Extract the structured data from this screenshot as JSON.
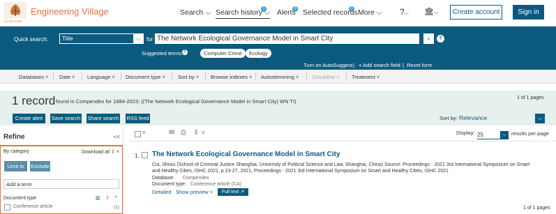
{
  "header": {
    "logo_name": "ELSEVIER",
    "app_title": "Engineering Village",
    "nav": {
      "search": "Search",
      "search_history": "Search history",
      "search_history_badge": "1",
      "alerts": "Alerts",
      "alerts_badge": "0",
      "selected_records": "Selected records",
      "selected_records_badge": "0",
      "more": "More"
    },
    "create_account": "Create account",
    "sign_in": "Sign in"
  },
  "search": {
    "quick_search_label": "Quick search:",
    "field_select": "Title",
    "for_label": "for",
    "query": "The Network Ecological Governance Model in Smart City",
    "suggested_label": "Suggested terms:",
    "suggested_terms": [
      "Computer Crime",
      "Ecology"
    ],
    "turn_on_autosuggest": "Turn on AutoSuggest",
    "add_search_field": "+ Add search field",
    "reset_form": "Reset form"
  },
  "filters": {
    "databases": "Databases",
    "date": "Date",
    "language": "Language",
    "document_type": "Document type",
    "sort_by": "Sort by",
    "browse_indexes": "Browse indexes",
    "autostemming": "Autostemming",
    "discipline": "Discipline",
    "treatment": "Treatment"
  },
  "results_header": {
    "count": "1 record",
    "description": "found in Compendex for 1884-2023: ((The Network Ecological Governance Model in Smart City) WN TI)",
    "pages_top": "1 of 1 pages",
    "buttons": {
      "create_alert": "Create alert",
      "save_search": "Save search",
      "share_search": "Share search",
      "rss_feed": "RSS feed"
    },
    "sort_by_label": "Sort by:",
    "sort_by_value": "Relevance"
  },
  "refine": {
    "title": "Refine",
    "collapse": "<<",
    "by_category": "By category",
    "download_all": "Download all",
    "limit_to": "Limit to",
    "exclude": "Exclude",
    "add_term_placeholder": "Add a term",
    "document_type": "Document type",
    "conference_article": "Conference article",
    "conference_count": "(1)"
  },
  "results": {
    "display_label": "Display:",
    "display_value": "25",
    "per_page": "results per page",
    "item": {
      "number": "1.",
      "title": "The Network Ecological Governance Model in Smart City",
      "authors_line_1": "Cui, Shixiu (School of Criminal Justice Shanghai, University of Political Science and Law, Shanghai, China) Source: Proceedings - 2021 3rd International Symposium on Smart",
      "authors_line_2": "and Healthy Cities, ISHC 2021, p 23-27, 2021, Proceedings - 2021 3rd International Symposium on Smart and Healthy Cities, ISHC 2021",
      "database_label": "Database:",
      "database_value": "Compendex",
      "doctype_label": "Document type:",
      "doctype_value": "Conference article (CA)",
      "detailed": "Detailed",
      "show_preview": "Show preview",
      "full_text": "Full text"
    },
    "pages_bottom": "1 of 1 pages"
  }
}
